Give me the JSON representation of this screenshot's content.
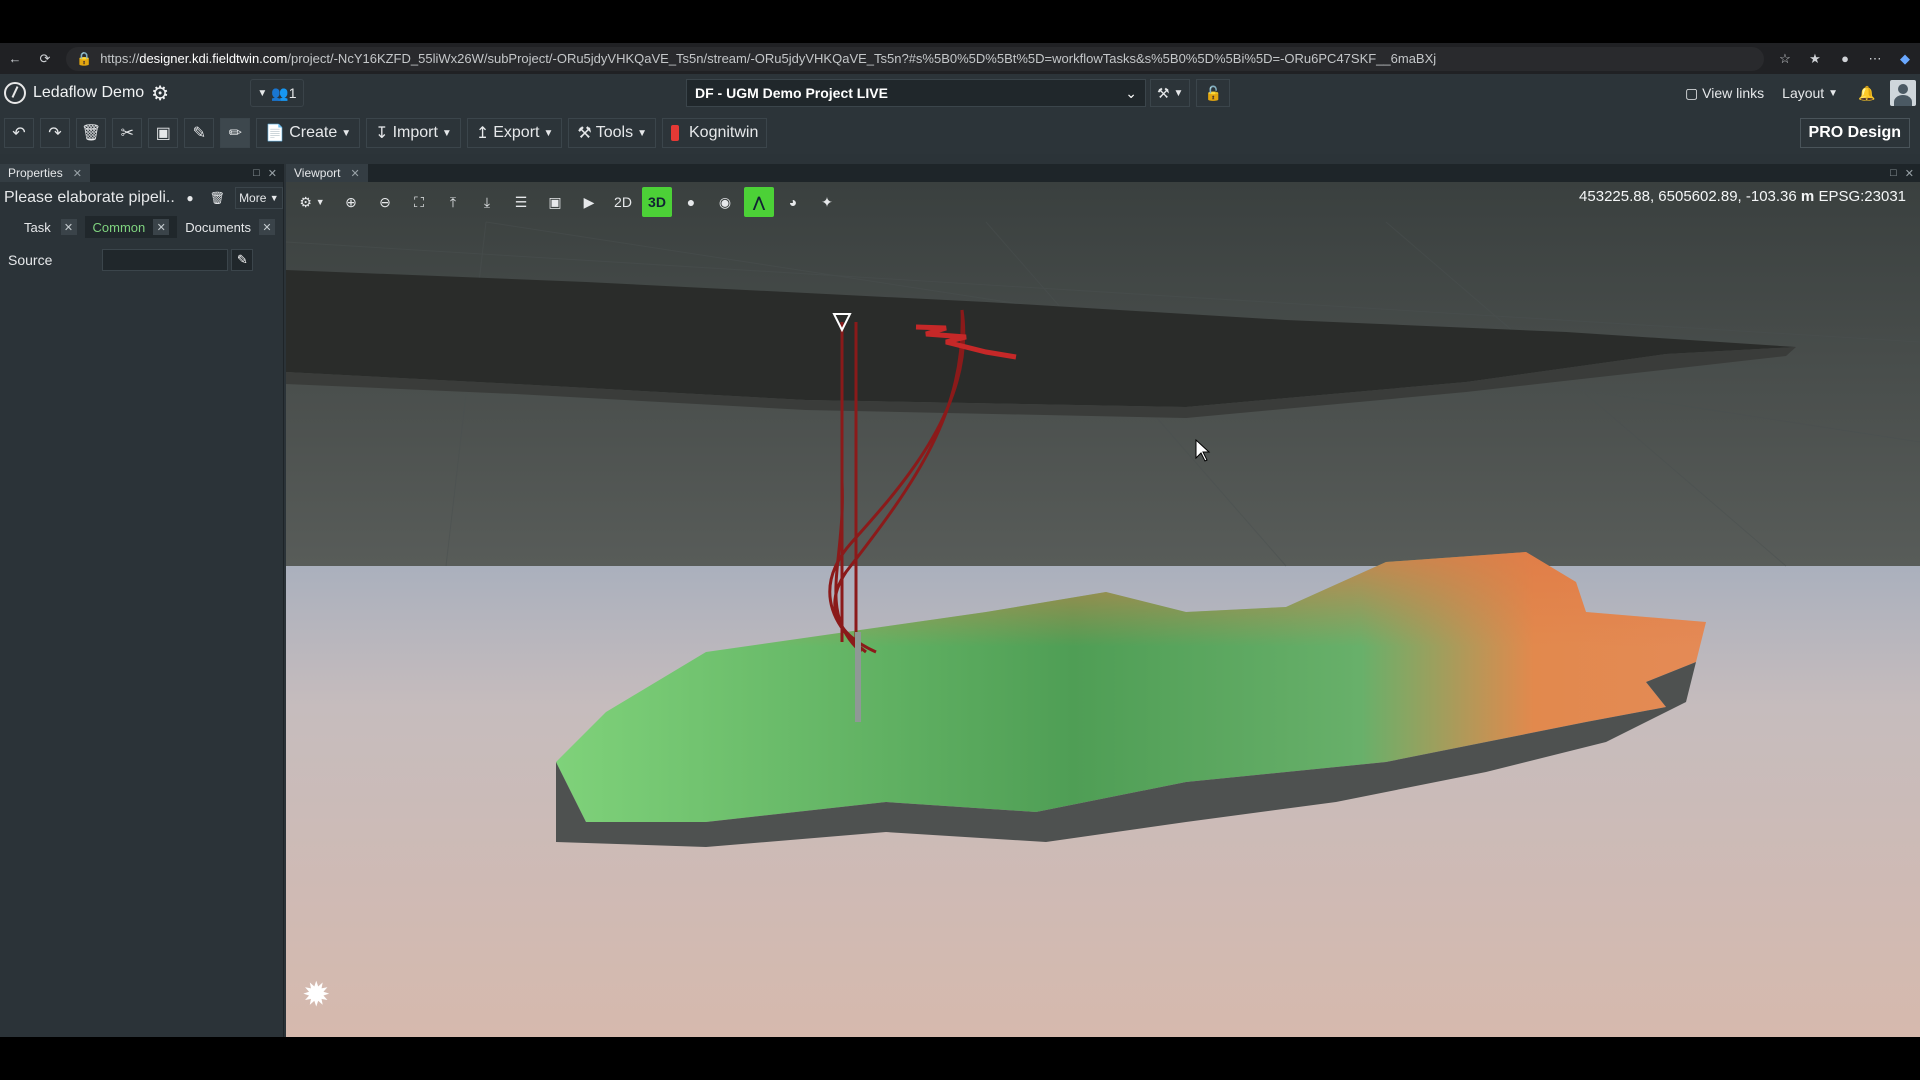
{
  "browser": {
    "url_host": "designer.kdi.fieldtwin.com",
    "url_rest": "/project/-NcY16KZFD_55liWx26W/subProject/-ORu5jdyVHKQaVE_Ts5n/stream/-ORu5jdyVHKQaVE_Ts5n?#s%5B0%5D%5Bt%5D=workflowTasks&s%5B0%5D%5Bi%5D=-ORu6PC47SKF__6maBXj"
  },
  "app": {
    "title": "Ledaflow Demo",
    "users_count": "1",
    "project": "DF - UGM Demo Project LIVE",
    "view_links": "View links",
    "layout": "Layout",
    "pro": "PRO Design"
  },
  "toolbar": {
    "create": "Create",
    "import": "Import",
    "export": "Export",
    "tools": "Tools",
    "kognitwin": "Kognitwin"
  },
  "properties": {
    "tab": "Properties",
    "task_title": "Please elaborate pipeli...",
    "more": "More",
    "subtabs": [
      "Task",
      "Common",
      "Documents"
    ],
    "source_label": "Source",
    "source_value": ""
  },
  "viewport": {
    "tab": "Viewport",
    "mode_2d": "2D",
    "mode_3d": "3D",
    "coords": "453225.88, 6505602.89, -103.36",
    "coords_unit": "m",
    "epsg": "EPSG:23031"
  },
  "colors": {
    "accent_green": "#4cd137",
    "well_red": "#8b1a1a"
  }
}
